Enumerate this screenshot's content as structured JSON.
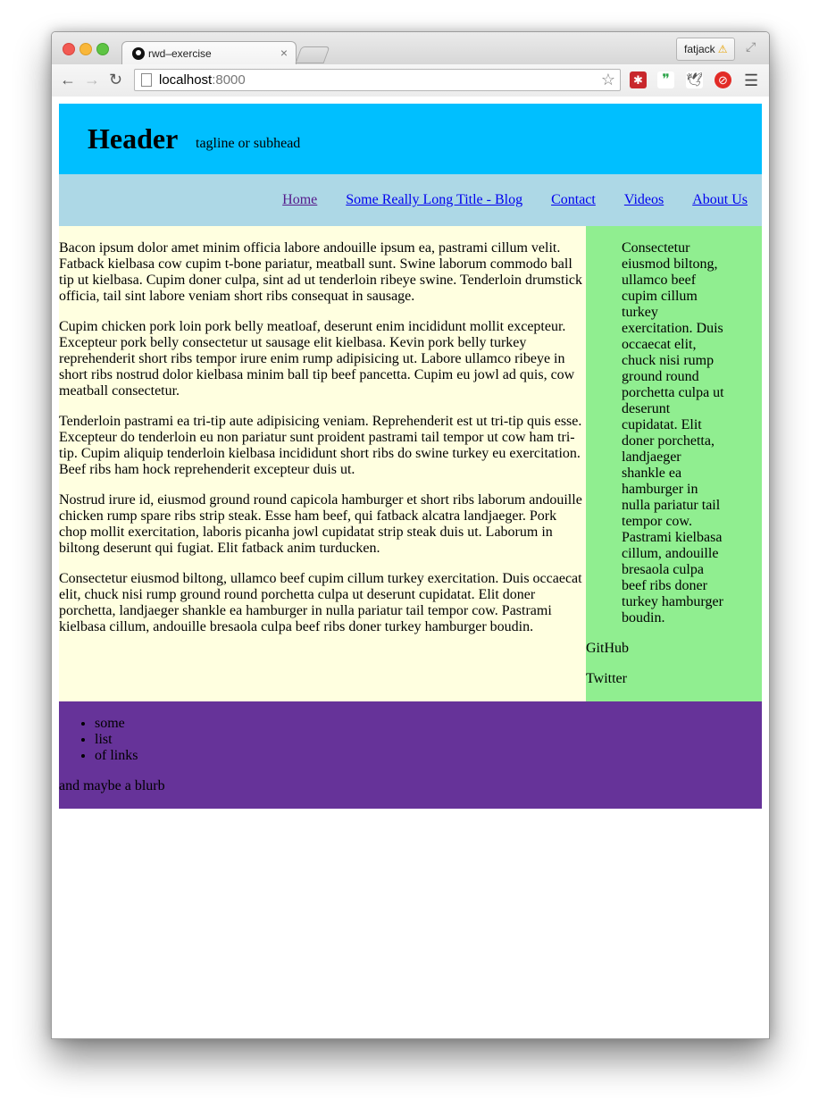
{
  "browser": {
    "tab_title": "rwd–exercise",
    "tab_close": "×",
    "profile_name": "fatjack",
    "profile_warning": "⚠",
    "url_host": "localhost",
    "url_port": ":8000",
    "icons": [
      "back-icon",
      "forward-icon",
      "reload-icon",
      "page-icon",
      "star-icon",
      "lastpass-icon",
      "hangouts-icon",
      "bird-icon",
      "adblock-icon",
      "menu-icon",
      "fullscreen-icon"
    ]
  },
  "header": {
    "title": "Header",
    "tagline": "tagline or subhead"
  },
  "nav": {
    "items": [
      {
        "label": "Home"
      },
      {
        "label": "Some Really Long Title - Blog"
      },
      {
        "label": "Contact"
      },
      {
        "label": "Videos"
      },
      {
        "label": "About Us"
      }
    ]
  },
  "main": {
    "paragraphs": [
      "Bacon ipsum dolor amet minim officia labore andouille ipsum ea, pastrami cillum velit. Fatback kielbasa cow cupim t-bone pariatur, meatball sunt. Swine laborum commodo ball tip ut kielbasa. Cupim doner culpa, sint ad ut tenderloin ribeye swine. Tenderloin drumstick officia, tail sint labore veniam short ribs consequat in sausage.",
      "Cupim chicken pork loin pork belly meatloaf, deserunt enim incididunt mollit excepteur. Excepteur pork belly consectetur ut sausage elit kielbasa. Kevin pork belly turkey reprehenderit short ribs tempor irure enim rump adipisicing ut. Labore ullamco ribeye in short ribs nostrud dolor kielbasa minim ball tip beef pancetta. Cupim eu jowl ad quis, cow meatball consectetur.",
      "Tenderloin pastrami ea tri-tip aute adipisicing veniam. Reprehenderit est ut tri-tip quis esse. Excepteur do tenderloin eu non pariatur sunt proident pastrami tail tempor ut cow ham tri-tip. Cupim aliquip tenderloin kielbasa incididunt short ribs do swine turkey eu exercitation. Beef ribs ham hock reprehenderit excepteur duis ut.",
      "Nostrud irure id, eiusmod ground round capicola hamburger et short ribs laborum andouille chicken rump spare ribs strip steak. Esse ham beef, qui fatback alcatra landjaeger. Pork chop mollit exercitation, laboris picanha jowl cupidatat strip steak duis ut. Laborum in biltong deserunt qui fugiat. Elit fatback anim turducken.",
      "Consectetur eiusmod biltong, ullamco beef cupim cillum turkey exercitation. Duis occaecat elit, chuck nisi rump ground round porchetta culpa ut deserunt cupidatat. Elit doner porchetta, landjaeger shankle ea hamburger in nulla pariatur tail tempor cow. Pastrami kielbasa cillum, andouille bresaola culpa beef ribs doner turkey hamburger boudin."
    ]
  },
  "sidebar": {
    "quote": "Consectetur eiusmod biltong, ullamco beef cupim cillum turkey exercitation. Duis occaecat elit, chuck nisi rump ground round porchetta culpa ut deserunt cupidatat. Elit doner porchetta, landjaeger shankle ea hamburger in nulla pariatur tail tempor cow. Pastrami kielbasa cillum, andouille bresaola culpa beef ribs doner turkey hamburger boudin.",
    "links": [
      "GitHub",
      "Twitter"
    ]
  },
  "footer": {
    "list": [
      "some",
      "list",
      "of links"
    ],
    "blurb": "and maybe a blurb"
  },
  "colors": {
    "header_bg": "#00bfff",
    "nav_bg": "#add8e6",
    "main_bg": "#ffffe0",
    "sidebar_bg": "#90ee90",
    "footer_bg": "#663399"
  }
}
